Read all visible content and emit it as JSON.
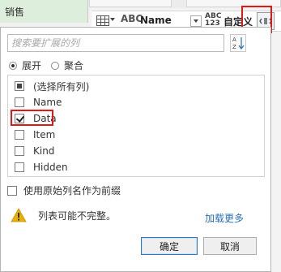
{
  "sheet_tab": {
    "label": "销售"
  },
  "column_header": {
    "col1_type": "ABC",
    "col1_name": "Name",
    "col2_type_top": "ABC",
    "col2_type_bottom": "123",
    "col2_name": "自定义"
  },
  "popup": {
    "search_placeholder": "搜索要扩展的列",
    "sort_icon": "sort-az-icon",
    "mode_options": [
      {
        "label": "展开",
        "selected": true
      },
      {
        "label": "聚合",
        "selected": false
      }
    ],
    "columns": [
      {
        "label": "(选择所有列)",
        "state": "partial"
      },
      {
        "label": "Name",
        "state": "unchecked"
      },
      {
        "label": "Data",
        "state": "checked"
      },
      {
        "label": "Item",
        "state": "unchecked"
      },
      {
        "label": "Kind",
        "state": "unchecked"
      },
      {
        "label": "Hidden",
        "state": "unchecked"
      }
    ],
    "prefix_label": "使用原始列名作为前缀",
    "prefix_checked": false,
    "warning_text": "列表可能不完整。",
    "load_more": "加载更多",
    "ok_label": "确定",
    "cancel_label": "取消"
  },
  "colors": {
    "highlight": "#e01818",
    "link": "#2b6fb3",
    "warning": "#e8b007",
    "sheet_tab": "#ddeedd"
  }
}
